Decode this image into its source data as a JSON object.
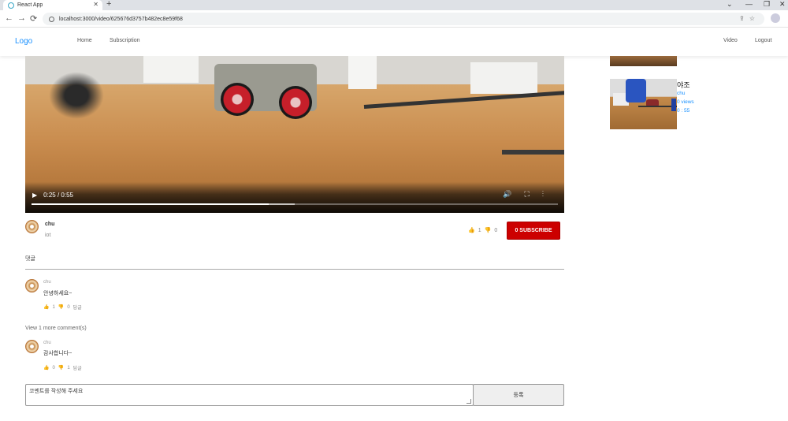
{
  "browser": {
    "tab_title": "React App",
    "tab_close": "✕",
    "new_tab": "+",
    "url": "localhost:3000/video/625676d3757b482ec8e59f68",
    "window_controls": [
      "⌄",
      "—",
      "❐",
      "✕"
    ],
    "nav": {
      "back": "←",
      "forward": "→",
      "reload": "⟳"
    },
    "omni_icons": "⇪☆"
  },
  "navbar": {
    "logo": "Logo",
    "left_links": [
      "Home",
      "Subscription"
    ],
    "right_links": [
      "Video",
      "Logout"
    ]
  },
  "player": {
    "current_time": "0:25",
    "duration": "0:55",
    "time_display": "0:25 / 0:55",
    "progress_fraction": 0.45,
    "controls": "🔊⛶⋮"
  },
  "video_info": {
    "uploader": "chu",
    "description": "iot",
    "likes": "1",
    "dislikes": "0",
    "subscribe_label": "0 SUBSCRIBE",
    "subscribe_color": "#cc0000"
  },
  "comments_section": {
    "title": "댓글",
    "comments": [
      {
        "author": "chu",
        "text": "안녕하세요~",
        "likes": "1",
        "dislikes": "0",
        "reply": "답글"
      },
      {
        "author": "chu",
        "text": "감사합니다~",
        "likes": "0",
        "dislikes": "1",
        "reply": "답글"
      }
    ],
    "view_more": "View 1 more comment(s)",
    "input_placeholder": "코멘트를 작성해 주세요",
    "submit_label": "등록"
  },
  "sidebar": {
    "items": [
      {
        "title": "야조",
        "author": "chu",
        "views": "0 views",
        "duration": "0 : 55"
      }
    ]
  },
  "colors": {
    "accent": "#1890ff",
    "subscribe": "#cc0000"
  }
}
